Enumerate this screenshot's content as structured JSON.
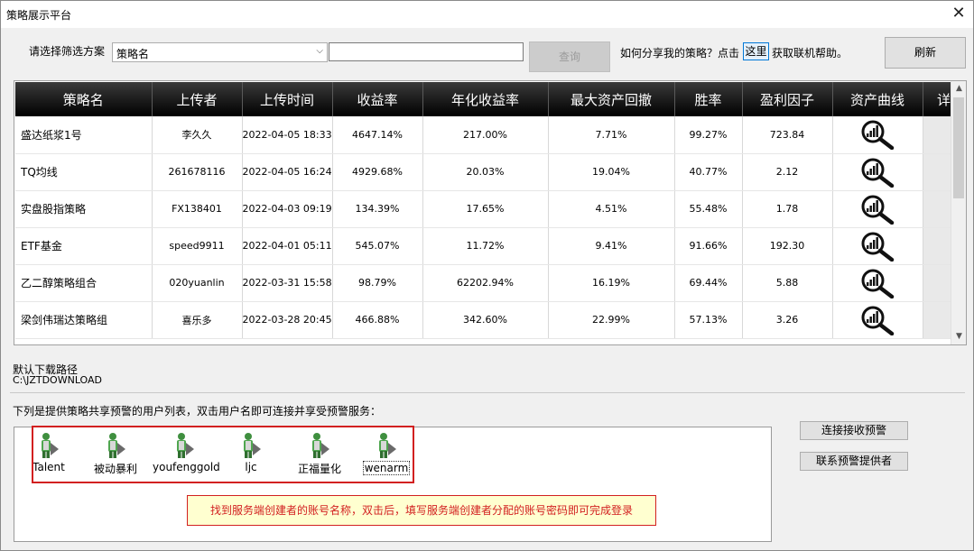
{
  "window": {
    "title": "策略展示平台",
    "close_glyph": "✕"
  },
  "filter": {
    "label": "请选择筛选方案",
    "selected": "策略名",
    "query_button": "查询",
    "share_prompt": "如何分享我的策略？点击",
    "here_button": "这里",
    "help_text": "获取联机帮助。",
    "refresh_button": "刷新"
  },
  "table": {
    "columns": [
      "策略名",
      "上传者",
      "上传时间",
      "收益率",
      "年化收益率",
      "最大资产回撤",
      "胜率",
      "盈利因子",
      "资产曲线",
      "详"
    ],
    "rows": [
      {
        "name": "盛达纸浆1号",
        "uploader": "李久久",
        "time": "2022-04-05 18:33",
        "return": "4647.14%",
        "annual": "217.00%",
        "drawdown": "7.71%",
        "winrate": "99.27%",
        "profit_factor": "723.84"
      },
      {
        "name": "TQ均线",
        "uploader": "261678116",
        "time": "2022-04-05 16:24",
        "return": "4929.68%",
        "annual": "20.03%",
        "drawdown": "19.04%",
        "winrate": "40.77%",
        "profit_factor": "2.12"
      },
      {
        "name": "实盘股指策略",
        "uploader": "FX138401",
        "time": "2022-04-03 09:19",
        "return": "134.39%",
        "annual": "17.65%",
        "drawdown": "4.51%",
        "winrate": "55.48%",
        "profit_factor": "1.78"
      },
      {
        "name": "ETF基金",
        "uploader": "speed9911",
        "time": "2022-04-01 05:11",
        "return": "545.07%",
        "annual": "11.72%",
        "drawdown": "9.41%",
        "winrate": "91.66%",
        "profit_factor": "192.30"
      },
      {
        "name": "乙二醇策略组合",
        "uploader": "020yuanlin",
        "time": "2022-03-31 15:58",
        "return": "98.79%",
        "annual": "62202.94%",
        "drawdown": "16.19%",
        "winrate": "69.44%",
        "profit_factor": "5.88"
      },
      {
        "name": "梁剑伟瑞达策略组",
        "uploader": "喜乐多",
        "time": "2022-03-28 20:45",
        "return": "466.88%",
        "annual": "342.60%",
        "drawdown": "22.99%",
        "winrate": "57.13%",
        "profit_factor": "3.26"
      }
    ],
    "curve_icon": "magnifier-chart-icon"
  },
  "download": {
    "label": "默认下载路径",
    "path": "C:\\JZTDOWNLOAD"
  },
  "users": {
    "intro": "下列是提供策略共享预警的用户列表，双击用户名即可连接并享受预警服务：",
    "list": [
      "Talent",
      "被动暴利",
      "youfenggold",
      "ljc",
      "正福量化",
      "wenarm"
    ],
    "icon": "person-icon",
    "connect_button": "连接接收预警",
    "contact_button": "联系预警提供者",
    "notice": "找到服务端创建者的账号名称，双击后，填写服务端创建者分配的账号密码即可完成登录"
  },
  "colors": {
    "header_bg": "#000000",
    "notice_border": "#d22020",
    "notice_bg": "#ffffd0"
  }
}
